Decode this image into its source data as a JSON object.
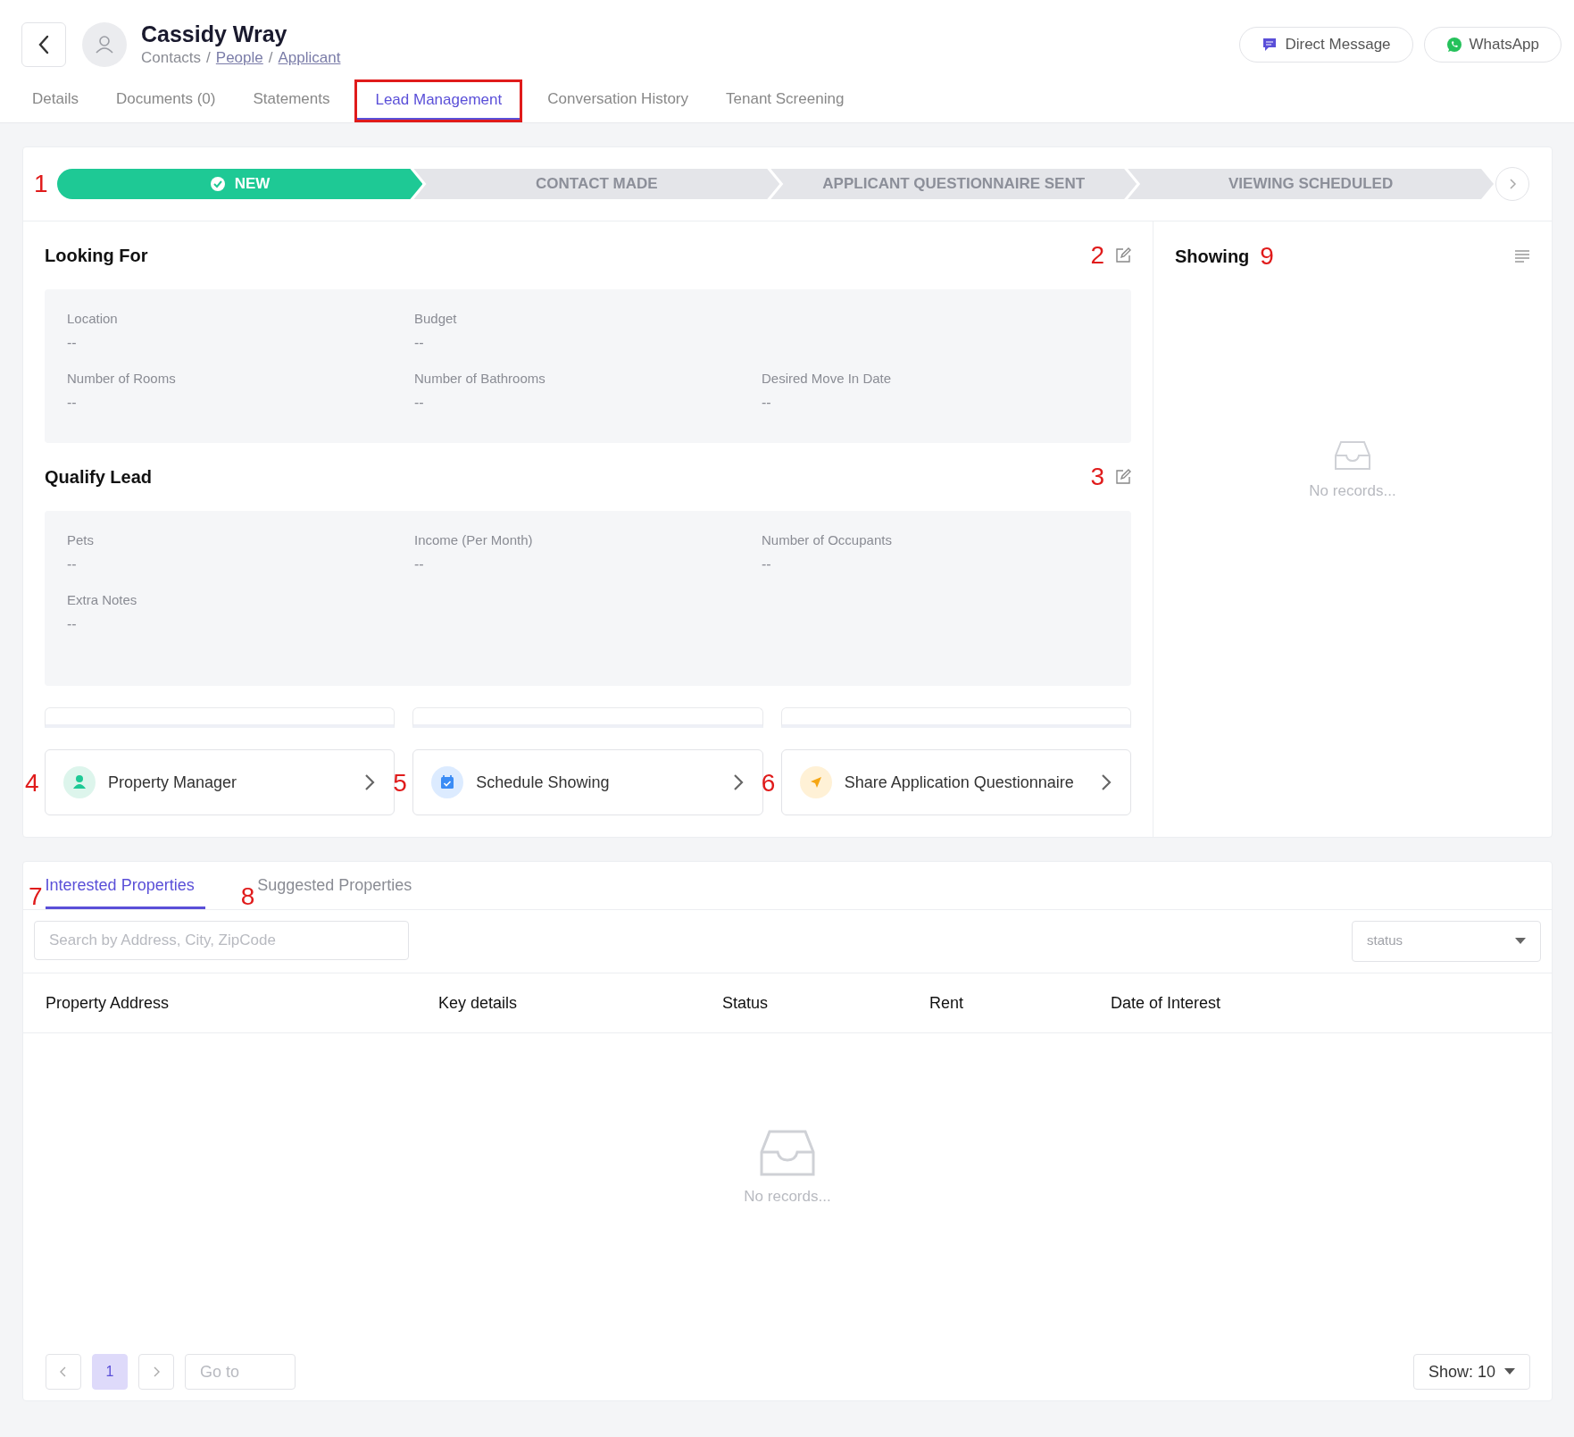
{
  "header": {
    "title": "Cassidy Wray",
    "breadcrumb": [
      {
        "label": "Contacts",
        "link": false,
        "separator": "/"
      },
      {
        "label": "People",
        "link": true,
        "separator": "/"
      },
      {
        "label": "Applicant",
        "link": true
      }
    ],
    "buttons": [
      {
        "kind": "message",
        "label": "Direct Message"
      },
      {
        "kind": "whatsapp",
        "label": "WhatsApp"
      }
    ]
  },
  "tabs": [
    {
      "label": "Details",
      "selected": false,
      "highlighted": false
    },
    {
      "label": "Documents (0)",
      "selected": false,
      "highlighted": false
    },
    {
      "label": "Statements",
      "selected": false,
      "highlighted": false
    },
    {
      "label": "Lead Management",
      "selected": true,
      "highlighted": true
    },
    {
      "label": "Conversation History",
      "selected": false,
      "highlighted": false
    },
    {
      "label": "Tenant Screening",
      "selected": false,
      "highlighted": false
    }
  ],
  "stages": {
    "marker": "1",
    "items": [
      {
        "label": "NEW",
        "selected": true
      },
      {
        "label": "CONTACT MADE",
        "selected": false
      },
      {
        "label": "APPLICANT QUESTIONNAIRE SENT",
        "selected": false
      },
      {
        "label": "VIEWING SCHEDULED",
        "selected": false
      }
    ]
  },
  "looking_for": {
    "title": "Looking For",
    "marker": "2",
    "rows": [
      [
        {
          "label": "Location",
          "value": "--"
        },
        {
          "label": "Budget",
          "value": "--"
        }
      ],
      [
        {
          "label": "Number of Rooms",
          "value": "--"
        },
        {
          "label": "Number of Bathrooms",
          "value": "--"
        },
        {
          "label": "Desired Move In Date",
          "value": "--"
        }
      ]
    ]
  },
  "qualify_lead": {
    "title": "Qualify Lead",
    "marker": "3",
    "rows": [
      [
        {
          "label": "Pets",
          "value": "--"
        },
        {
          "label": "Income (Per Month)",
          "value": "--"
        },
        {
          "label": "Number of Occupants",
          "value": "--"
        }
      ],
      [
        {
          "label": "Extra Notes",
          "value": "--"
        }
      ]
    ]
  },
  "actions": [
    {
      "kind": "person",
      "label": "Property Manager",
      "marker": "4"
    },
    {
      "kind": "calendar",
      "label": "Schedule Showing",
      "marker": "5"
    },
    {
      "kind": "send",
      "label": "Share Application Questionnaire",
      "marker": "6"
    }
  ],
  "showing": {
    "title": "Showing",
    "marker": "9",
    "empty": "No records..."
  },
  "properties": {
    "tabs": [
      {
        "label": "Interested Properties",
        "marker": "7",
        "selected": true
      },
      {
        "label": "Suggested Properties",
        "marker": "8",
        "selected": false
      }
    ],
    "search": {
      "placeholder": "Search by Address, City, ZipCode"
    },
    "status_filter": {
      "placeholder": "status"
    },
    "columns": [
      "Property Address",
      "Key details",
      "Status",
      "Rent",
      "Date of Interest"
    ],
    "empty": "No records...",
    "pagination": {
      "pages": [
        {
          "label": "1",
          "selected": true
        }
      ],
      "goto_placeholder": "Go to",
      "page_size": "Show: 10"
    }
  }
}
